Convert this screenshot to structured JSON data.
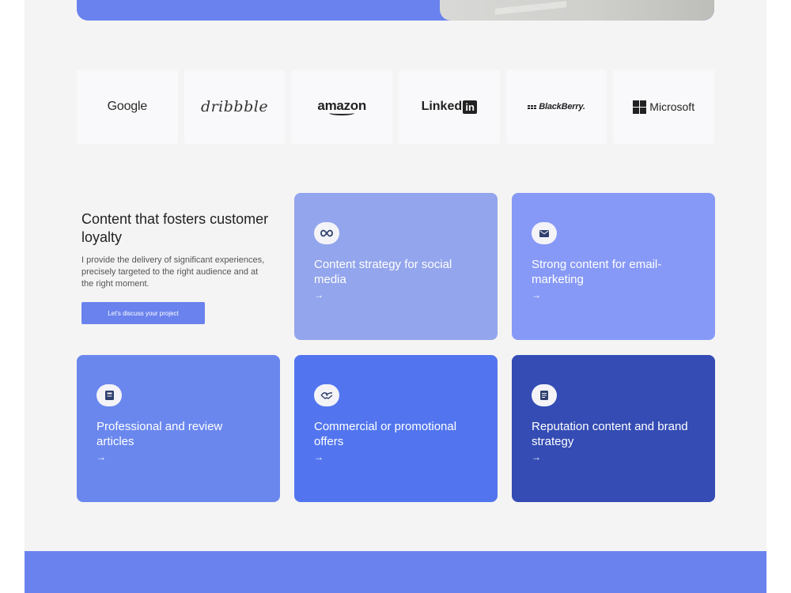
{
  "logos": [
    {
      "name": "Google"
    },
    {
      "name": "dribbble"
    },
    {
      "name": "amazon"
    },
    {
      "name": "Linked",
      "badge": "in"
    },
    {
      "name": "BlackBerry."
    },
    {
      "name": "Microsoft"
    }
  ],
  "intro": {
    "title": "Content that fosters customer loyalty",
    "body": "I provide the delivery of significant experiences, precisely targeted to the right audience and at the right moment.",
    "cta_label": "Let's discuss your project"
  },
  "services": [
    {
      "title": "Content strategy for social media",
      "icon": "infinity-icon",
      "arrow": "→",
      "color": "#93a5ec"
    },
    {
      "title": "Strong content for email-marketing",
      "icon": "mail-icon",
      "arrow": "→",
      "color": "#8799f6"
    },
    {
      "title": "Professional and review articles",
      "icon": "book-icon",
      "arrow": "→",
      "color": "#6a87ee"
    },
    {
      "title": "Commercial or promotional offers",
      "icon": "handshake-icon",
      "arrow": "→",
      "color": "#5275ef"
    },
    {
      "title": "Reputation content and brand strategy",
      "icon": "document-icon",
      "arrow": "→",
      "color": "#344cb4"
    }
  ],
  "colors": {
    "accent": "#6a82ee",
    "page_bg": "#f4f4f4"
  }
}
